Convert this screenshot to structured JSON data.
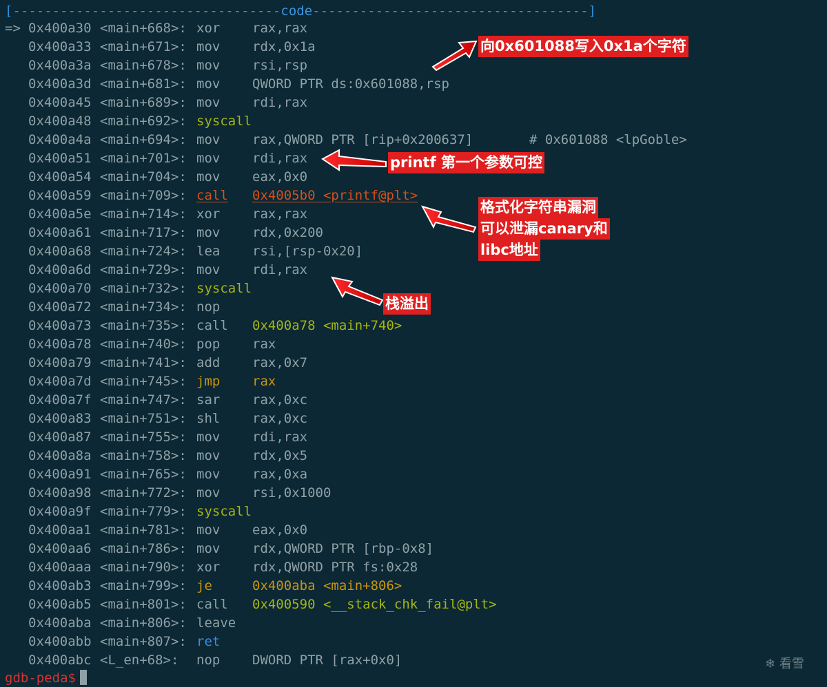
{
  "header": {
    "left": "[----------------------------------",
    "title": "code",
    "right": "-----------------------------------]"
  },
  "rows": [
    {
      "ptr": "=>",
      "addr": "0x400a30",
      "sym": "<main+668>:",
      "mnemonic": "xor",
      "operands": "rax,rax",
      "comment": "",
      "mcolor": "c-grey",
      "ocolor": "c-grey"
    },
    {
      "ptr": "",
      "addr": "0x400a33",
      "sym": "<main+671>:",
      "mnemonic": "mov",
      "operands": "rdx,0x1a",
      "comment": "",
      "mcolor": "c-grey",
      "ocolor": "c-grey"
    },
    {
      "ptr": "",
      "addr": "0x400a3a",
      "sym": "<main+678>:",
      "mnemonic": "mov",
      "operands": "rsi,rsp",
      "comment": "",
      "mcolor": "c-grey",
      "ocolor": "c-grey"
    },
    {
      "ptr": "",
      "addr": "0x400a3d",
      "sym": "<main+681>:",
      "mnemonic": "mov",
      "operands": "QWORD PTR ds:0x601088,rsp",
      "comment": "",
      "mcolor": "c-grey",
      "ocolor": "c-grey"
    },
    {
      "ptr": "",
      "addr": "0x400a45",
      "sym": "<main+689>:",
      "mnemonic": "mov",
      "operands": "rdi,rax",
      "comment": "",
      "mcolor": "c-grey",
      "ocolor": "c-grey"
    },
    {
      "ptr": "",
      "addr": "0x400a48",
      "sym": "<main+692>:",
      "mnemonic": "syscall",
      "operands": "",
      "comment": "",
      "mcolor": "c-green",
      "ocolor": "c-grey"
    },
    {
      "ptr": "",
      "addr": "0x400a4a",
      "sym": "<main+694>:",
      "mnemonic": "mov",
      "operands": "rax,QWORD PTR [rip+0x200637]",
      "comment": "# 0x601088 <lpGoble>",
      "mcolor": "c-grey",
      "ocolor": "c-grey"
    },
    {
      "ptr": "",
      "addr": "0x400a51",
      "sym": "<main+701>:",
      "mnemonic": "mov",
      "operands": "rdi,rax",
      "comment": "",
      "mcolor": "c-grey",
      "ocolor": "c-grey"
    },
    {
      "ptr": "",
      "addr": "0x400a54",
      "sym": "<main+704>:",
      "mnemonic": "mov",
      "operands": "eax,0x0",
      "comment": "",
      "mcolor": "c-grey",
      "ocolor": "c-grey"
    },
    {
      "ptr": "",
      "addr": "0x400a59",
      "sym": "<main+709>:",
      "mnemonic": "call",
      "operands": "0x4005b0 <printf@plt>",
      "comment": "",
      "mcolor": "c-orange underl",
      "ocolor": "c-orange underl"
    },
    {
      "ptr": "",
      "addr": "0x400a5e",
      "sym": "<main+714>:",
      "mnemonic": "xor",
      "operands": "rax,rax",
      "comment": "",
      "mcolor": "c-grey",
      "ocolor": "c-grey"
    },
    {
      "ptr": "",
      "addr": "0x400a61",
      "sym": "<main+717>:",
      "mnemonic": "mov",
      "operands": "rdx,0x200",
      "comment": "",
      "mcolor": "c-grey",
      "ocolor": "c-grey"
    },
    {
      "ptr": "",
      "addr": "0x400a68",
      "sym": "<main+724>:",
      "mnemonic": "lea",
      "operands": "rsi,[rsp-0x20]",
      "comment": "",
      "mcolor": "c-grey",
      "ocolor": "c-grey"
    },
    {
      "ptr": "",
      "addr": "0x400a6d",
      "sym": "<main+729>:",
      "mnemonic": "mov",
      "operands": "rdi,rax",
      "comment": "",
      "mcolor": "c-grey",
      "ocolor": "c-grey"
    },
    {
      "ptr": "",
      "addr": "0x400a70",
      "sym": "<main+732>:",
      "mnemonic": "syscall",
      "operands": "",
      "comment": "",
      "mcolor": "c-green",
      "ocolor": "c-grey"
    },
    {
      "ptr": "",
      "addr": "0x400a72",
      "sym": "<main+734>:",
      "mnemonic": "nop",
      "operands": "",
      "comment": "",
      "mcolor": "c-grey",
      "ocolor": "c-grey"
    },
    {
      "ptr": "",
      "addr": "0x400a73",
      "sym": "<main+735>:",
      "mnemonic": "call",
      "operands": "0x400a78 <main+740>",
      "comment": "",
      "mcolor": "c-grey",
      "ocolor": "c-green"
    },
    {
      "ptr": "",
      "addr": "0x400a78",
      "sym": "<main+740>:",
      "mnemonic": "pop",
      "operands": "rax",
      "comment": "",
      "mcolor": "c-grey",
      "ocolor": "c-grey"
    },
    {
      "ptr": "",
      "addr": "0x400a79",
      "sym": "<main+741>:",
      "mnemonic": "add",
      "operands": "rax,0x7",
      "comment": "",
      "mcolor": "c-grey",
      "ocolor": "c-grey"
    },
    {
      "ptr": "",
      "addr": "0x400a7d",
      "sym": "<main+745>:",
      "mnemonic": "jmp",
      "operands": "rax",
      "comment": "",
      "mcolor": "c-gold",
      "ocolor": "c-gold"
    },
    {
      "ptr": "",
      "addr": "0x400a7f",
      "sym": "<main+747>:",
      "mnemonic": "sar",
      "operands": "rax,0xc",
      "comment": "",
      "mcolor": "c-grey",
      "ocolor": "c-grey"
    },
    {
      "ptr": "",
      "addr": "0x400a83",
      "sym": "<main+751>:",
      "mnemonic": "shl",
      "operands": "rax,0xc",
      "comment": "",
      "mcolor": "c-grey",
      "ocolor": "c-grey"
    },
    {
      "ptr": "",
      "addr": "0x400a87",
      "sym": "<main+755>:",
      "mnemonic": "mov",
      "operands": "rdi,rax",
      "comment": "",
      "mcolor": "c-grey",
      "ocolor": "c-grey"
    },
    {
      "ptr": "",
      "addr": "0x400a8a",
      "sym": "<main+758>:",
      "mnemonic": "mov",
      "operands": "rdx,0x5",
      "comment": "",
      "mcolor": "c-grey",
      "ocolor": "c-grey"
    },
    {
      "ptr": "",
      "addr": "0x400a91",
      "sym": "<main+765>:",
      "mnemonic": "mov",
      "operands": "rax,0xa",
      "comment": "",
      "mcolor": "c-grey",
      "ocolor": "c-grey"
    },
    {
      "ptr": "",
      "addr": "0x400a98",
      "sym": "<main+772>:",
      "mnemonic": "mov",
      "operands": "rsi,0x1000",
      "comment": "",
      "mcolor": "c-grey",
      "ocolor": "c-grey"
    },
    {
      "ptr": "",
      "addr": "0x400a9f",
      "sym": "<main+779>:",
      "mnemonic": "syscall",
      "operands": "",
      "comment": "",
      "mcolor": "c-green",
      "ocolor": "c-grey"
    },
    {
      "ptr": "",
      "addr": "0x400aa1",
      "sym": "<main+781>:",
      "mnemonic": "mov",
      "operands": "eax,0x0",
      "comment": "",
      "mcolor": "c-grey",
      "ocolor": "c-grey"
    },
    {
      "ptr": "",
      "addr": "0x400aa6",
      "sym": "<main+786>:",
      "mnemonic": "mov",
      "operands": "rdx,QWORD PTR [rbp-0x8]",
      "comment": "",
      "mcolor": "c-grey",
      "ocolor": "c-grey"
    },
    {
      "ptr": "",
      "addr": "0x400aaa",
      "sym": "<main+790>:",
      "mnemonic": "xor",
      "operands": "rdx,QWORD PTR fs:0x28",
      "comment": "",
      "mcolor": "c-grey",
      "ocolor": "c-grey"
    },
    {
      "ptr": "",
      "addr": "0x400ab3",
      "sym": "<main+799>:",
      "mnemonic": "je",
      "operands": "0x400aba <main+806>",
      "comment": "",
      "mcolor": "c-gold",
      "ocolor": "c-gold"
    },
    {
      "ptr": "",
      "addr": "0x400ab5",
      "sym": "<main+801>:",
      "mnemonic": "call",
      "operands": "0x400590 <__stack_chk_fail@plt>",
      "comment": "",
      "mcolor": "c-grey",
      "ocolor": "c-green"
    },
    {
      "ptr": "",
      "addr": "0x400aba",
      "sym": "<main+806>:",
      "mnemonic": "leave",
      "operands": "",
      "comment": "",
      "mcolor": "c-grey",
      "ocolor": "c-grey"
    },
    {
      "ptr": "",
      "addr": "0x400abb",
      "sym": "<main+807>:",
      "mnemonic": "ret",
      "operands": "",
      "comment": "",
      "mcolor": "c-blue",
      "ocolor": "c-grey"
    },
    {
      "ptr": "",
      "addr": "0x400abc",
      "sym": "<L_en+68>:",
      "mnemonic": "nop",
      "operands": "DWORD PTR [rax+0x0]",
      "comment": "",
      "mcolor": "c-grey",
      "ocolor": "c-grey"
    }
  ],
  "prompt": {
    "text": "gdb-peda$"
  },
  "annotations": {
    "write": "向0x601088写入0x1a个字符",
    "printf": "printf 第一个参数可控",
    "fmt_line1": "格式化字符串漏洞",
    "fmt_line2": "可以泄漏canary和",
    "fmt_line3": "libc地址",
    "overflow": "栈溢出"
  },
  "watermark": {
    "icon": "snowflake-icon",
    "text": "看雪"
  },
  "colors": {
    "background": "#0b2834",
    "text": "#8fa0a6",
    "green": "#a7b514",
    "orange": "#d6501a",
    "gold": "#c99410",
    "blue": "#3c8edc",
    "prompt": "#d33633",
    "annotation_bg": "#e02020"
  }
}
